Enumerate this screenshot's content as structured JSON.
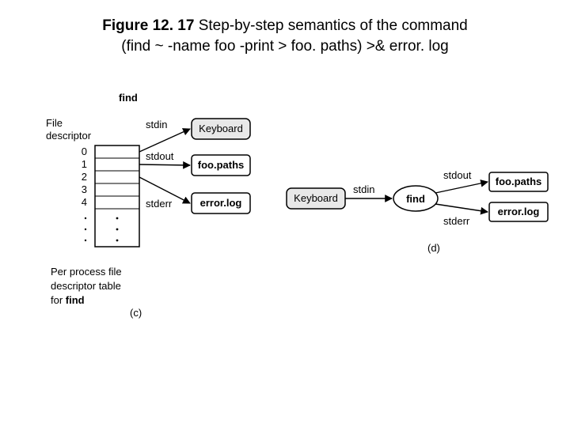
{
  "title": {
    "prefix": "Figure 12. 17",
    "rest": "  Step-by-step semantics of the command",
    "line2": "(find ~ -name foo -print > foo. paths) >& error. log"
  },
  "left": {
    "fd_label_1": "File",
    "fd_label_2": "descriptor",
    "process_header": "find",
    "nums": [
      "0",
      "1",
      "2",
      "3",
      "4"
    ],
    "caption1": "Per process file",
    "caption2": "descriptor table",
    "caption3_prefix": "for ",
    "caption3_bold": "find",
    "sub": "(c)",
    "stdin": "stdin",
    "stdout": "stdout",
    "stderr": "stderr",
    "keyboard": "Keyboard",
    "foopaths": "foo.paths",
    "errorlog": "error.log"
  },
  "right": {
    "keyboard": "Keyboard",
    "stdin": "stdin",
    "find": "find",
    "stdout": "stdout",
    "stderr": "stderr",
    "foopaths": "foo.paths",
    "errorlog": "error.log",
    "sub": "(d)"
  }
}
